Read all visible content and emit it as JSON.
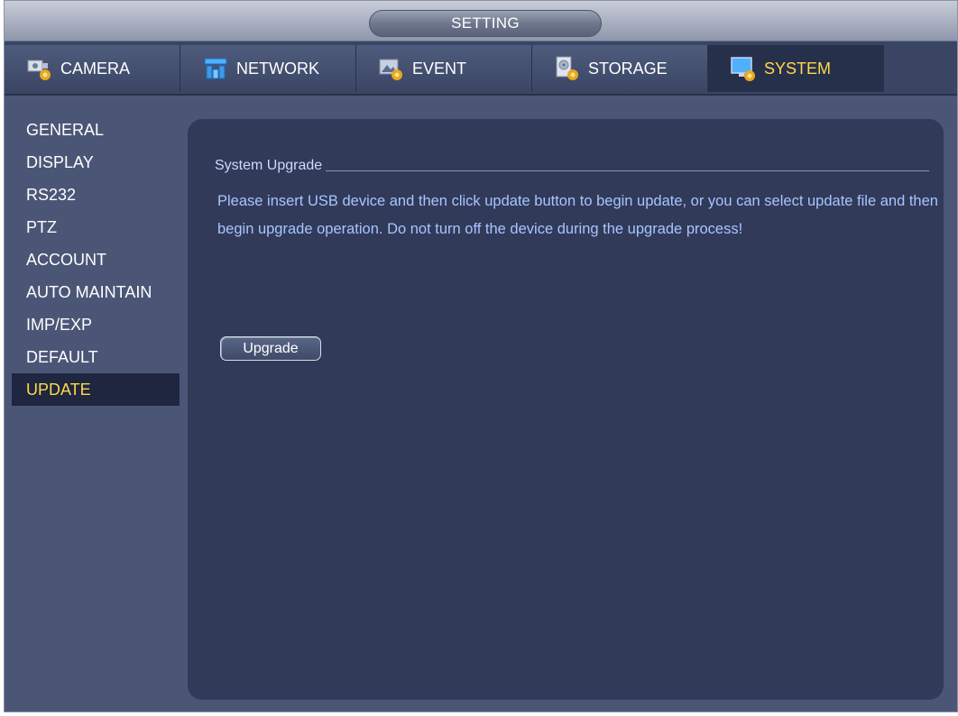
{
  "window": {
    "title": "SETTING"
  },
  "tabs": [
    {
      "label": "CAMERA",
      "icon": "camera-settings-icon",
      "active": false
    },
    {
      "label": "NETWORK",
      "icon": "network-icon",
      "active": false
    },
    {
      "label": "EVENT",
      "icon": "event-icon",
      "active": false
    },
    {
      "label": "STORAGE",
      "icon": "storage-icon",
      "active": false
    },
    {
      "label": "SYSTEM",
      "icon": "system-monitor-icon",
      "active": true
    }
  ],
  "sidebar": {
    "items": [
      {
        "label": "GENERAL"
      },
      {
        "label": "DISPLAY"
      },
      {
        "label": "RS232"
      },
      {
        "label": "PTZ"
      },
      {
        "label": "ACCOUNT"
      },
      {
        "label": "AUTO MAINTAIN"
      },
      {
        "label": "IMP/EXP"
      },
      {
        "label": "DEFAULT"
      },
      {
        "label": "UPDATE",
        "active": true
      }
    ]
  },
  "main": {
    "section_title": "System Upgrade",
    "description": "Please insert USB device and then click update button to begin update, or you can select update file and then begin upgrade operation. Do not turn off the device during the upgrade process!",
    "upgrade_button": "Upgrade"
  },
  "colors": {
    "active_text": "#ffd84a",
    "description_text": "#a8c4ff",
    "panel_bg": "#313a59",
    "window_bg": "#4b5677"
  }
}
